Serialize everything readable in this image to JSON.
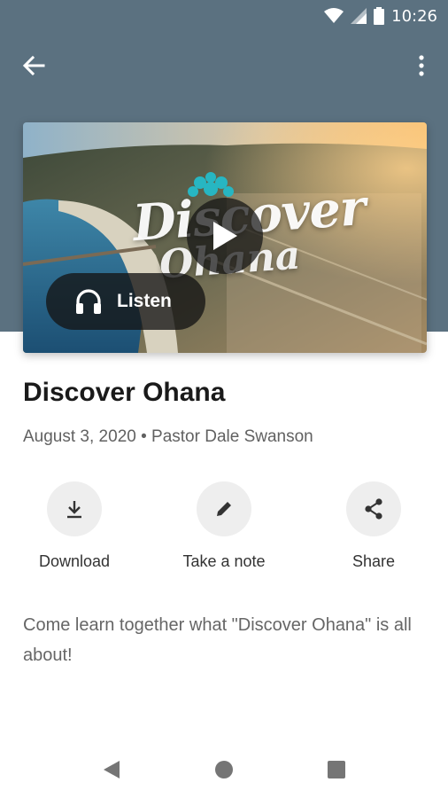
{
  "status_bar": {
    "time": "10:26"
  },
  "sermon": {
    "title": "Discover Ohana",
    "meta": "August 3, 2020 • Pastor Dale Swanson",
    "description": "Come learn together what \"Discover Ohana\" is all about!",
    "hero_art_text": {
      "line1": "Discover",
      "line2": "Ohana"
    }
  },
  "media": {
    "listen_label": "Listen"
  },
  "actions": [
    {
      "label": "Download",
      "icon": "download-icon"
    },
    {
      "label": "Take a note",
      "icon": "pencil-icon"
    },
    {
      "label": "Share",
      "icon": "share-icon"
    }
  ],
  "colors": {
    "header": "#5b7180",
    "action_bg": "#eeeeee"
  }
}
